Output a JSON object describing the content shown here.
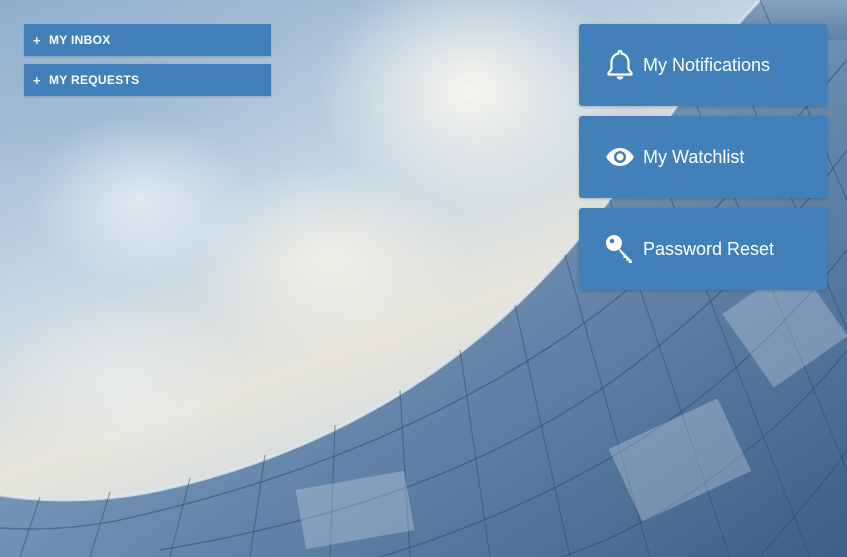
{
  "accordions": {
    "inbox": {
      "toggle": "+",
      "label": "MY INBOX"
    },
    "requests": {
      "toggle": "+",
      "label": "MY REQUESTS"
    }
  },
  "tiles": [
    {
      "label": "My Notifications",
      "icon": "bell-icon"
    },
    {
      "label": "My Watchlist",
      "icon": "eye-icon"
    },
    {
      "label": "Password Reset",
      "icon": "key-icon"
    }
  ],
  "colors": {
    "button_bg": "#4180b8",
    "button_text": "#ffffff"
  }
}
